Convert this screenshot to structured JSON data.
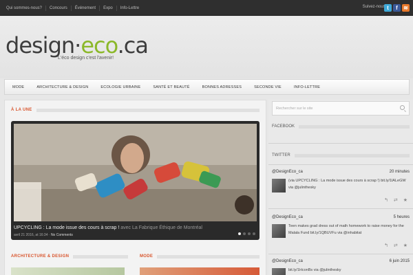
{
  "topbar": {
    "links": [
      "Qui sommes-nous?",
      "Concours",
      "Événement",
      "Expo",
      "Info-Lettre"
    ],
    "follow_label": "Suivez-nous :",
    "social": [
      {
        "icon": "twitter-icon",
        "glyph": "t"
      },
      {
        "icon": "facebook-icon",
        "glyph": "f"
      },
      {
        "icon": "rss-icon",
        "glyph": "≋"
      }
    ]
  },
  "header": {
    "logo_part1": "design·",
    "logo_part2": "eco",
    "logo_part3": ".ca",
    "tagline": "L'éco design c'est l'avenir!"
  },
  "menu": [
    "Mode",
    "Architecture & Design",
    "Ecologie urbaine",
    "Santé et beauté",
    "Bonnes adresses",
    "Seconde vie",
    "Info-Lettre"
  ],
  "main": {
    "featured_title": "À la une",
    "slide": {
      "title": "UPCYCLING : La mode issue des cours à scrap !",
      "title_extra": " avec La Fabrique Éthique de Montréal",
      "date": "avril 21 2016, at 16:34",
      "comments": "No Comments"
    },
    "section_left": "Architecture & Design",
    "section_right": "Mode"
  },
  "sidebar": {
    "search_placeholder": "Rechercher sur le site",
    "facebook_title": "Facebook",
    "twitter_title": "Twitter",
    "tweets": [
      {
        "user": "@DesignEco_ca",
        "time": "20 minutes",
        "text": "(via UPCYCLING : La mode issue des cours à scrap !) bit.ly/1lALeGW via @julinthesky"
      },
      {
        "user": "@DesignEco_ca",
        "time": "5 heures",
        "text": "Teen makes grad dress out of math homework to raise money for the Malala Fund bit.ly/1QBUVFu via @inhabitat"
      },
      {
        "user": "@DesignEco_ca",
        "time": "6 juin 2015",
        "text": "bit.ly/1HconBs via @julinthesky"
      }
    ],
    "actions": "↰ ⇄ ★"
  },
  "colors": {
    "accent": "#d8542c",
    "logo_green": "#8bb829",
    "topbar": "#2f2f2f"
  }
}
